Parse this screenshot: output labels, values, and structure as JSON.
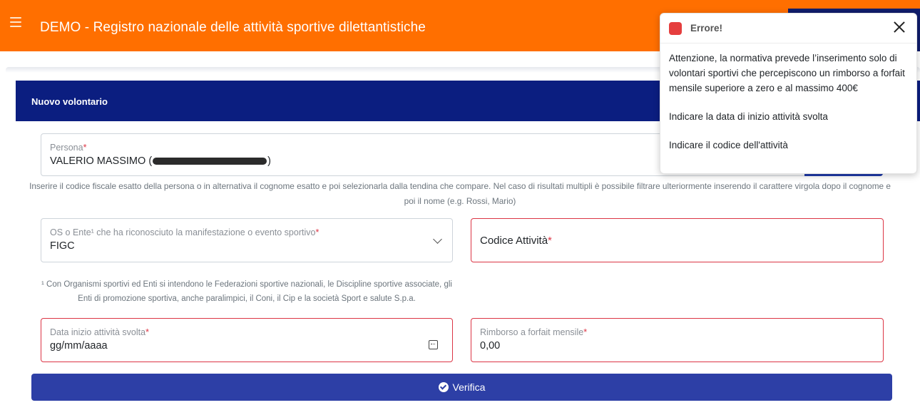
{
  "topbar": {
    "title": "DEMO - Registro nazionale delle attività sportive dilettantistiche",
    "menu_icon": "hamburger-icon",
    "color": "#ff6f00"
  },
  "card": {
    "title": "Nuovo volontario",
    "header_color": "#0b1e80"
  },
  "persona": {
    "label": "Persona",
    "required": "*",
    "value_prefix": "VALERIO MASSIMO (",
    "value_suffix": ")"
  },
  "hint": "Inserire il codice fiscale esatto della persona o in alternativa il cognome esatto e poi selezionarla dalla tendina che compare. Nel caso di risultati multipli è possibile filtrare ulteriormente inserendo il carattere virgola dopo il cognome e poi il nome (e.g. Rossi, Mario)",
  "os": {
    "label": "OS o Ente¹ che ha riconosciuto la manifestazione o evento sportivo",
    "required": "*",
    "value": "FIGC"
  },
  "codice": {
    "label": "Codice Attività",
    "required": "*"
  },
  "footnote": "¹ Con Organismi sportivi ed Enti si intendono le Federazioni sportive nazionali, le Discipline sportive associate, gli Enti di promozione sportiva, anche paralimpici, il Coni, il Cip e la società Sport e salute S.p.a.",
  "data_inizio": {
    "label": "Data inizio attività svolta",
    "required": "*",
    "value": "gg/mm/aaaa"
  },
  "rimborso": {
    "label": "Rimborso a forfait mensile",
    "required": "*",
    "value": "0,00"
  },
  "verifica": {
    "label": "Verifica"
  },
  "toast": {
    "title": "Errore!",
    "messages": [
      "Attenzione, la normativa prevede l’inserimento solo di volontari sportivi che percepiscono un rimborso a forfait mensile superiore a zero e al massimo 400€",
      "Indicare la data di inizio attività svolta",
      "Indicare il codice dell'attività"
    ],
    "accent": "#e53e3e"
  }
}
